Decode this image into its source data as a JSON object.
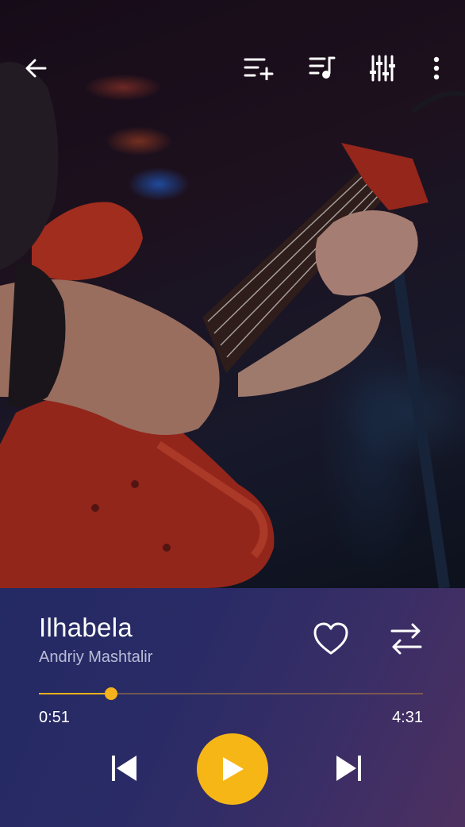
{
  "topbar": {
    "icons": [
      "back-arrow-icon",
      "add-to-playlist-icon",
      "queue-music-icon",
      "equalizer-icon",
      "more-vertical-icon"
    ]
  },
  "artwork": {
    "subject": "guitar-player-photo"
  },
  "track": {
    "title": "Ilhabela",
    "artist": "Andriy Mashtalir"
  },
  "progress": {
    "current_time": "0:51",
    "total_time": "4:31",
    "fraction": 0.188
  },
  "controls": {
    "icons": [
      "heart-icon",
      "repeat-icon",
      "skip-previous-icon",
      "play-icon",
      "skip-next-icon"
    ]
  },
  "colors": {
    "accent": "#f6b716",
    "panel_start": "#242a63",
    "panel_end": "#4d3060",
    "artist_text": "#b9bcd8"
  }
}
